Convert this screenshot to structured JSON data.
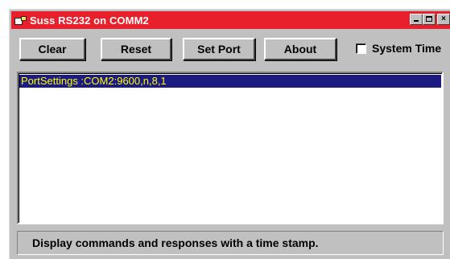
{
  "window": {
    "title": "Suss RS232 on COMM2",
    "icon": "serial-port-app-icon",
    "title_bar_color": "#e8202c",
    "controls": {
      "minimize": "minimize-icon",
      "maximize": "maximize-icon",
      "close": "×"
    }
  },
  "toolbar": {
    "clear_label": "Clear",
    "reset_label": "Reset",
    "set_port_label": "Set Port",
    "about_label": "About",
    "system_time_label": "System Time",
    "system_time_checked": false
  },
  "log": {
    "selected_highlight_color": "#1b1b82",
    "selected_text_color": "#ffff00",
    "lines": [
      "PortSettings :COM2:9600,n,8,1"
    ]
  },
  "status": {
    "text": "Display commands and responses with a time stamp."
  }
}
